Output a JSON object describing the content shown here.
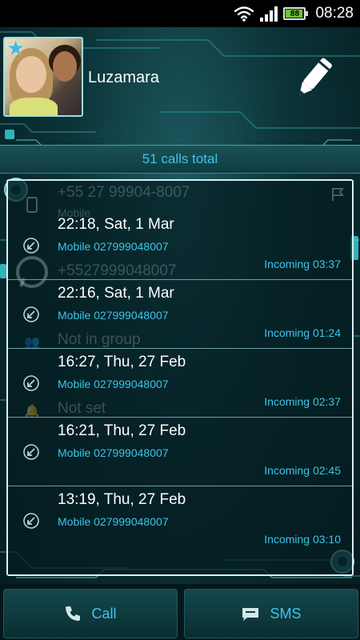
{
  "status_bar": {
    "battery_level": "88",
    "battery_fraction": 0.88,
    "time": "08:28",
    "icons": [
      "wifi-icon",
      "signal-icon",
      "battery-icon"
    ]
  },
  "contact": {
    "name": "Luzamara",
    "favorite_icon": "star-icon",
    "edit_icon": "pencil-icon"
  },
  "summary": {
    "calls_total": "51 calls total"
  },
  "background_ghost_text": {
    "number_formatted": "+55 27 99904-8007",
    "number_label": "Mobile",
    "whatsapp_number": "+5527999048007",
    "group": "Not in group",
    "ringtone": "Not set"
  },
  "calls": [
    {
      "date": "22:18, Sat, 1 Mar",
      "number": "Mobile 027999048007",
      "status": "Incoming 03:37"
    },
    {
      "date": "22:16, Sat, 1 Mar",
      "number": "Mobile 027999048007",
      "status": "Incoming 01:24"
    },
    {
      "date": "16:27, Thu, 27 Feb",
      "number": "Mobile 027999048007",
      "status": "Incoming 02:37"
    },
    {
      "date": "16:21, Thu, 27 Feb",
      "number": "Mobile 027999048007",
      "status": "Incoming 02:45"
    },
    {
      "date": "13:19, Thu, 27 Feb",
      "number": "Mobile 027999048007",
      "status": "Incoming 03:10"
    }
  ],
  "actions": {
    "call_label": "Call",
    "sms_label": "SMS"
  },
  "colors": {
    "accent": "#3ec4ea",
    "panel_border": "#d8f0f2",
    "background": "#06262a"
  }
}
